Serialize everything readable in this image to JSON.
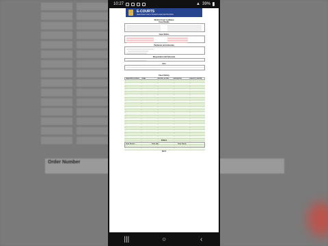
{
  "status_bar": {
    "time": "10:27",
    "battery": "39%"
  },
  "banner": {
    "title": "E-COURTS",
    "subtitle": "SERVICES FOR LITIGANTS AND ADVOCATES"
  },
  "doc": {
    "court_name": "District Court Ludhiana",
    "case_details_title": "Case Details",
    "case_status_title": "Case Status",
    "petitioner_title": "Petitioner and Advocate",
    "respondent_title": "Respondent and Advocate",
    "acts_title": "Acts",
    "history_title": "Case History",
    "orders_title": "Orders",
    "back_label": "Back",
    "history_headers": [
      "Registration Number",
      "Judge",
      "Business on Date",
      "Hearing Date",
      "Purpose of Hearing"
    ],
    "history_rows": [
      [
        "...",
        "...",
        "...",
        "...",
        "..."
      ],
      [
        "...",
        "...",
        "...",
        "...",
        "..."
      ],
      [
        "...",
        "...",
        "...",
        "...",
        "..."
      ],
      [
        "...",
        "...",
        "...",
        "...",
        "..."
      ],
      [
        "...",
        "...",
        "...",
        "...",
        "..."
      ],
      [
        "...",
        "...",
        "...",
        "...",
        "..."
      ],
      [
        "...",
        "...",
        "...",
        "...",
        "..."
      ],
      [
        "...",
        "...",
        "...",
        "...",
        "..."
      ],
      [
        "...",
        "...",
        "...",
        "...",
        "..."
      ],
      [
        "...",
        "...",
        "...",
        "...",
        "..."
      ],
      [
        "...",
        "...",
        "...",
        "...",
        "..."
      ],
      [
        "...",
        "...",
        "...",
        "...",
        "..."
      ],
      [
        "...",
        "...",
        "...",
        "...",
        "..."
      ],
      [
        "...",
        "...",
        "...",
        "...",
        "..."
      ],
      [
        "...",
        "...",
        "...",
        "...",
        "..."
      ],
      [
        "...",
        "...",
        "...",
        "...",
        "..."
      ],
      [
        "...",
        "...",
        "...",
        "...",
        "..."
      ],
      [
        "...",
        "...",
        "...",
        "...",
        "..."
      ],
      [
        "...",
        "...",
        "...",
        "...",
        "..."
      ],
      [
        "...",
        "...",
        "...",
        "...",
        "..."
      ],
      [
        "...",
        "...",
        "...",
        "...",
        "..."
      ],
      [
        "...",
        "...",
        "...",
        "...",
        "..."
      ],
      [
        "...",
        "...",
        "...",
        "...",
        "..."
      ],
      [
        "...",
        "...",
        "...",
        "...",
        "..."
      ]
    ],
    "orders_headers": [
      "Order Number",
      "Order Date",
      "Order Details"
    ]
  },
  "background": {
    "order_header": "Order Number"
  },
  "navbar": {
    "recents": "|||",
    "home": "○",
    "back": "‹"
  }
}
